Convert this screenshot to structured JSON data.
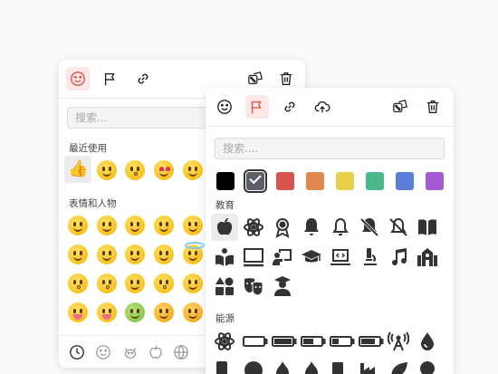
{
  "back_panel": {
    "toolbar": {
      "icons": [
        "smile-icon",
        "flag-icon",
        "link-icon",
        "dice-icon",
        "trash-icon"
      ],
      "active": "smile-icon"
    },
    "search": {
      "placeholder": "搜索..."
    },
    "recent": {
      "title": "最近使用",
      "items": [
        "thumbs-up",
        "grinning-face",
        "face-blowing-kiss",
        "heart-eyes-face",
        "laughing-face"
      ]
    },
    "people": {
      "title": "表情和人物"
    },
    "bottom_tabs": [
      "recent-clock-icon",
      "smiley-icon",
      "animal-icon",
      "food-apple-icon",
      "activity-ball-icon"
    ]
  },
  "front_panel": {
    "toolbar": {
      "icons": [
        "smile-icon",
        "flag-icon",
        "link-icon",
        "upload-cloud-icon",
        "dice-icon",
        "trash-icon"
      ],
      "active": "flag-icon"
    },
    "search": {
      "placeholder": "搜索...."
    },
    "colors": [
      "#000000",
      "#5a5f66",
      "#d9534f",
      "#e0894f",
      "#e8d04a",
      "#4cb88a",
      "#5b7fd6",
      "#a659d6"
    ],
    "selected_color": "#5a5f66",
    "education": {
      "title": "教育",
      "icons": [
        "apple-icon",
        "atom-icon",
        "award-ribbon-icon",
        "bell-filled-icon",
        "bell-outline-icon",
        "bell-slash-filled-icon",
        "bell-slash-outline-icon",
        "book-open-icon",
        "book-reader-icon",
        "chalkboard-icon",
        "chalkboard-teacher-icon",
        "graduation-cap-icon",
        "laptop-code-icon",
        "microscope-icon",
        "music-icon",
        "school-icon",
        "shapes-icon",
        "theater-masks-icon",
        "user-graduate-icon"
      ]
    },
    "energy": {
      "title": "能源",
      "icons": [
        "atom-icon",
        "battery-empty-icon",
        "battery-full-icon",
        "battery-half-icon",
        "battery-quarter-icon",
        "battery-three-quarters-icon",
        "broadcast-tower-icon",
        "water-drop-icon"
      ]
    }
  }
}
